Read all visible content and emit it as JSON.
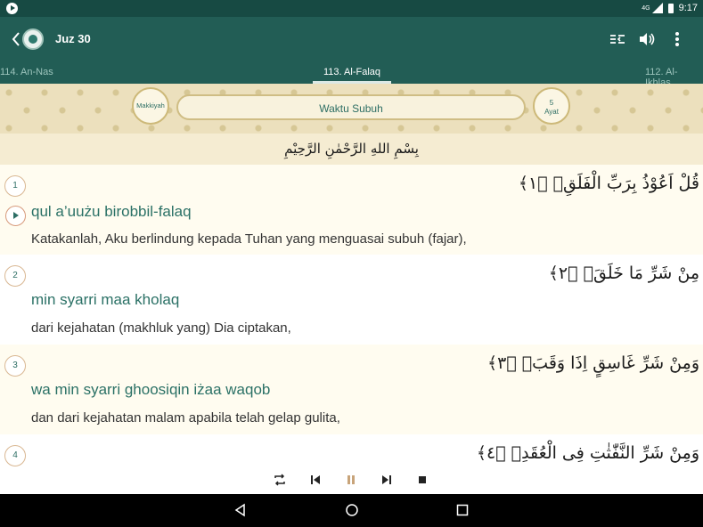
{
  "status": {
    "network": "4G",
    "time": "9:17"
  },
  "appbar": {
    "title": "Juz 30"
  },
  "tabs": [
    {
      "label": "114. An-Nas"
    },
    {
      "label": "113. Al-Falaq"
    },
    {
      "label": "112. Al-Ikhlas"
    }
  ],
  "surah_header": {
    "revelation": "Makkiyah",
    "name": "Waktu Subuh",
    "ayat_count": "5",
    "ayat_label": "Ayat"
  },
  "basmala": "بِسْمِ اللهِ الرَّحْمٰنِ الرَّحِيْمِ",
  "verses": [
    {
      "number": "1",
      "arabic": "قُلْ اَعُوْذُ بِرَبِّ الْفَلَقِۙ ﴿١﴾",
      "latin": "qul a’uużu birobbil-falaq",
      "translation": "Katakanlah, Aku berlindung kepada Tuhan yang menguasai subuh (fajar),"
    },
    {
      "number": "2",
      "arabic": "مِنْ شَرِّ مَا خَلَقَۙ ﴿٢﴾",
      "latin": "min syarri maa kholaq",
      "translation": "dari kejahatan (makhluk yang) Dia ciptakan,"
    },
    {
      "number": "3",
      "arabic": "وَمِنْ شَرِّ غَاسِقٍ اِذَا وَقَبَۙ ﴿٣﴾",
      "latin": "wa min syarri ghoosiqin iżaa waqob",
      "translation": "dan dari kejahatan malam apabila telah gelap gulita,"
    },
    {
      "number": "4",
      "arabic": "وَمِنْ شَرِّ النَّفّٰثٰتِ فِى الْعُقَدِۙ ﴿٤﴾",
      "latin": "",
      "translation": ""
    }
  ],
  "colors": {
    "primary": "#225d55",
    "accent": "#2b7166",
    "ornament": "#ece0bd"
  }
}
